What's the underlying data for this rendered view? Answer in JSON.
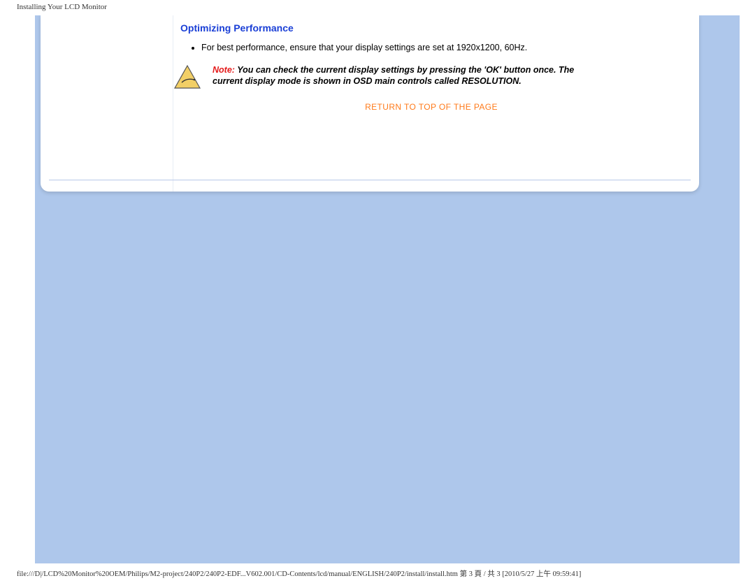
{
  "header": {
    "title": "Installing Your LCD Monitor"
  },
  "section": {
    "heading": "Optimizing Performance",
    "bullet1": "For best performance, ensure that your display settings are set at 1920x1200, 60Hz."
  },
  "note": {
    "label": "Note:",
    "body": " You can check the current display settings by pressing the 'OK' button once. The current display mode is shown in OSD main controls called RESOLUTION."
  },
  "links": {
    "return_top": "RETURN TO TOP OF THE PAGE"
  },
  "footer": {
    "path": "file:///D|/LCD%20Monitor%20OEM/Philips/M2-project/240P2/240P2-EDF...V602.001/CD-Contents/lcd/manual/ENGLISH/240P2/install/install.htm 第 3 頁 / 共 3  [2010/5/27 上午 09:59:41]"
  }
}
